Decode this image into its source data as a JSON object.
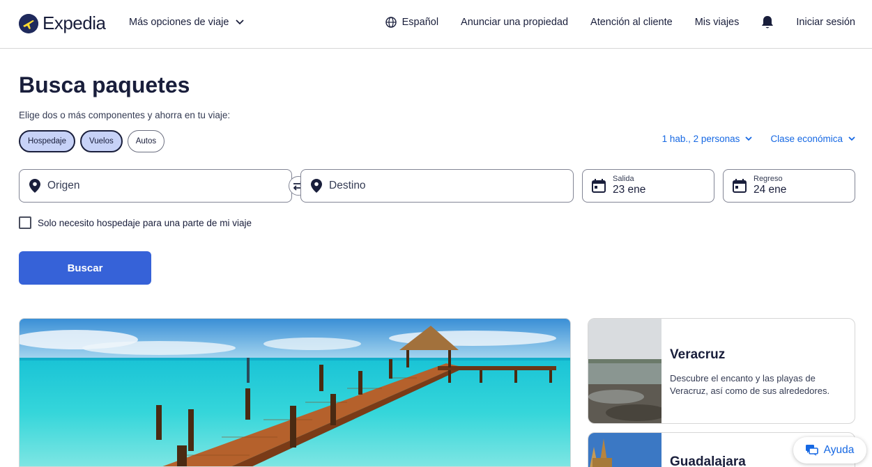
{
  "header": {
    "logo_text": "Expedia",
    "more_options": "Más opciones de viaje",
    "language": "Español",
    "list_property": "Anunciar una propiedad",
    "support": "Atención al cliente",
    "my_trips": "Mis viajes",
    "sign_in": "Iniciar sesión"
  },
  "main": {
    "title": "Busca paquetes",
    "subtitle": "Elige dos o más componentes y ahorra en tu viaje:",
    "chips": [
      {
        "label": "Hospedaje",
        "selected": true
      },
      {
        "label": "Vuelos",
        "selected": true
      },
      {
        "label": "Autos",
        "selected": false
      }
    ],
    "travelers": "1 hab., 2 personas",
    "cabin_class": "Clase económica",
    "origin_placeholder": "Origen",
    "destination_placeholder": "Destino",
    "depart": {
      "label": "Salida",
      "value": "23 ene"
    },
    "return": {
      "label": "Regreso",
      "value": "24 ene"
    },
    "partial_stay": "Solo necesito hospedaje para una parte de mi viaje",
    "search_button": "Buscar"
  },
  "cards": [
    {
      "title": "Veracruz",
      "description": "Descubre el encanto y las playas de Veracruz, así como de sus alrededores."
    },
    {
      "title": "Guadalajara",
      "description": ""
    }
  ],
  "help_button": "Ayuda",
  "colors": {
    "brand_navy": "#191e3b",
    "accent_blue": "#1668e3",
    "button_blue": "#3662d8",
    "chip_selected": "#c7d2f7"
  }
}
